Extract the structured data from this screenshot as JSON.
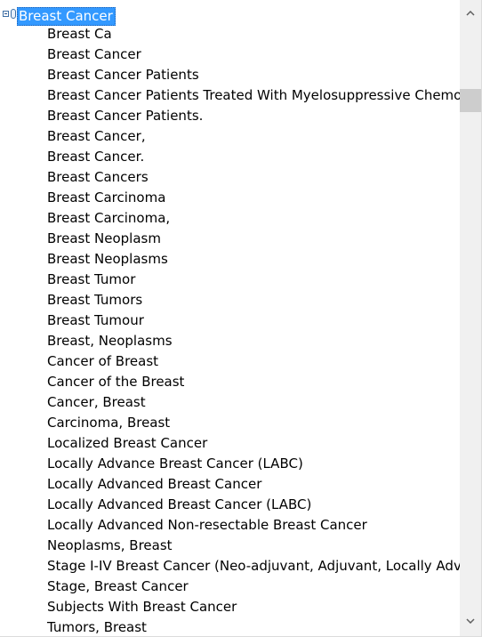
{
  "tree": {
    "root": {
      "label": "Breast Cancer",
      "expanded": true,
      "selected": true
    },
    "children": [
      "Breast Ca",
      "Breast Cancer",
      "Breast Cancer Patients",
      "Breast Cancer Patients Treated With Myelosuppressive Chemot...",
      "Breast Cancer Patients.",
      "Breast Cancer,",
      "Breast Cancer.",
      "Breast Cancers",
      "Breast Carcinoma",
      "Breast Carcinoma,",
      "Breast Neoplasm",
      "Breast Neoplasms",
      "Breast Tumor",
      "Breast Tumors",
      "Breast Tumour",
      "Breast, Neoplasms",
      "Cancer of Breast",
      "Cancer of the Breast",
      "Cancer, Breast",
      "Carcinoma, Breast",
      "Localized Breast Cancer",
      "Locally Advance Breast Cancer (LABC)",
      "Locally Advanced Breast Cancer",
      "Locally Advanced Breast Cancer (LABC)",
      "Locally Advanced Non-resectable Breast Cancer",
      "Neoplasms, Breast",
      "Stage I-IV Breast Cancer (Neo-adjuvant, Adjuvant, Locally Adv...",
      "Stage, Breast Cancer",
      "Subjects With Breast Cancer",
      "Tumors, Breast"
    ]
  },
  "icons": {
    "collapse": "collapse-minus-icon",
    "node": "concept-node-icon",
    "scroll_up": "chevron-up-icon",
    "scroll_down": "chevron-down-icon"
  },
  "colors": {
    "selection_background": "#3399ff",
    "selection_text": "#ffffff",
    "scrollbar_track": "#f0f0f0",
    "scrollbar_thumb": "#cdcdcd"
  }
}
